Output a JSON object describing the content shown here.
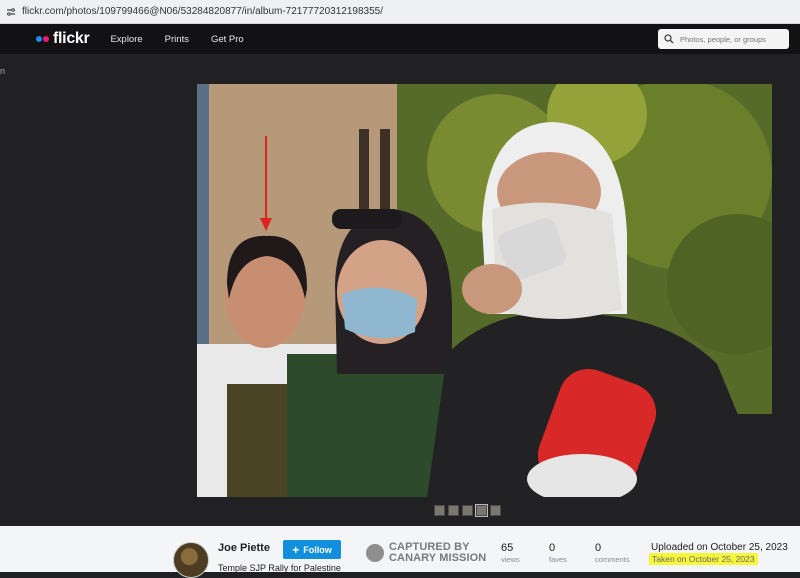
{
  "browser": {
    "url": "flickr.com/photos/109799466@N06/53284820877/in/album-72177720312198355/"
  },
  "nav": {
    "logo": "flickr",
    "links": [
      "Explore",
      "Prints",
      "Get Pro"
    ],
    "search_placeholder": "Photos, people, or groups"
  },
  "viewer": {
    "side_glyph": "n",
    "annotation_color": "#e0221e",
    "thumbnail_count": 5,
    "active_thumbnail": 4
  },
  "info": {
    "author": "Joe Piette",
    "follow_label": "Follow",
    "album_title": "Temple SJP Rally for Palestine",
    "watermark_line1": "CAPTURED BY",
    "watermark_line2": "CANARY MISSION",
    "stats": [
      {
        "value": "65",
        "label": "views"
      },
      {
        "value": "0",
        "label": "faves"
      },
      {
        "value": "0",
        "label": "comments"
      }
    ],
    "uploaded": "Uploaded on October 25, 2023",
    "taken": "Taken on October 25, 2023",
    "highlight_color": "#f6f63c",
    "accent": "#128fdc"
  }
}
